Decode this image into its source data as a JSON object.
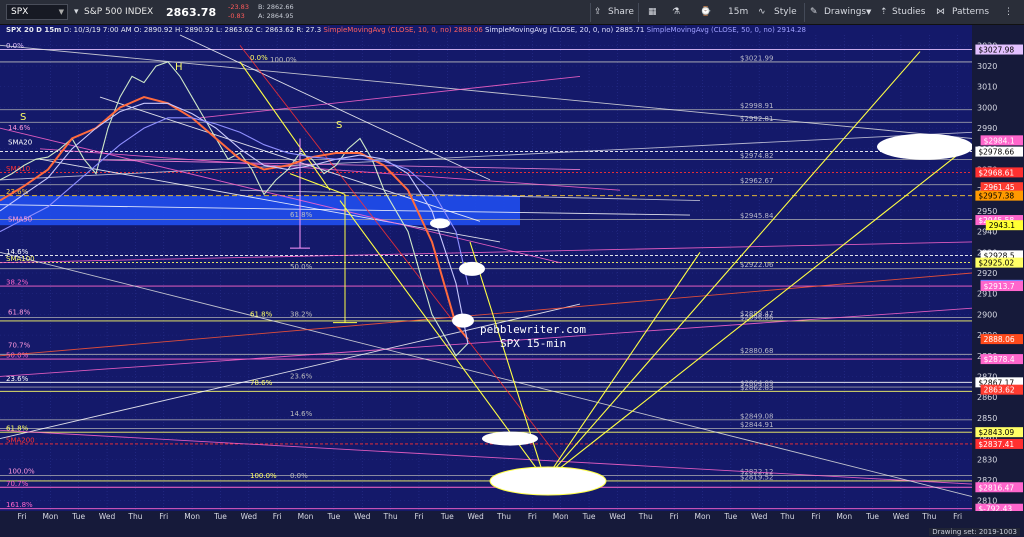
{
  "toolbar": {
    "symbol": "SPX",
    "instrument": "S&P 500 INDEX",
    "last_price": "2863.78",
    "change_pts": "-23.83",
    "change_pct": "-0.83",
    "bid": "B: 2862.66",
    "ask": "A: 2864.95",
    "share_label": "Share",
    "interval": "15m",
    "style_label": "Style",
    "drawings_label": "Drawings",
    "studies_label": "Studies",
    "patterns_label": "Patterns"
  },
  "status_line": {
    "title": "SPX 20 D 15m",
    "ohlc": "D: 10/3/19 7:00 AM   O: 2890.92   H: 2890.92   L: 2863.62   C: 2863.62   R: 27.3",
    "sma10_label": "SimpleMovingAvg (CLOSE, 10, 0, no)",
    "sma10_value": "2888.06",
    "sma20_label": "SimpleMovingAvg (CLOSE, 20, 0, no)",
    "sma20_value": "2885.71",
    "sma50_label": "SimpleMovingAvg (CLOSE, 50, 0, no)",
    "sma50_value": "2914.28"
  },
  "watermark": {
    "site": "pebblewriter.com",
    "subtitle": "SPX 15-min"
  },
  "drawing_set": "Drawing set: 2019-1003",
  "chart_data": {
    "type": "line",
    "title": "SPX 20 D 15m",
    "ylim": [
      2805,
      3035
    ],
    "yticks": [
      2810,
      2820,
      2830,
      2840,
      2850,
      2860,
      2870,
      2880,
      2890,
      2900,
      2910,
      2920,
      2930,
      2940,
      2950,
      2960,
      2970,
      2980,
      2990,
      3000,
      3010,
      3020,
      3030
    ],
    "x_labels": [
      "Fri",
      "Mon",
      "Tue",
      "Wed",
      "Thu",
      "Fri",
      "Mon",
      "Tue",
      "Wed",
      "Fri",
      "Mon",
      "Tue",
      "Wed",
      "Thu",
      "Fri",
      "Tue",
      "Wed",
      "Thu",
      "Fri",
      "Mon",
      "Tue",
      "Wed",
      "Thu",
      "Fri",
      "Mon",
      "Tue",
      "Wed",
      "Thu",
      "Fri",
      "Mon",
      "Tue",
      "Wed",
      "Thu",
      "Fri"
    ],
    "series": [
      {
        "name": "SPX",
        "color": "#cfe8c8",
        "x": [
          0,
          4,
          8,
          12,
          16,
          20,
          24,
          28,
          32,
          36,
          40,
          44,
          48,
          52,
          56,
          60,
          64,
          68,
          72,
          76,
          80,
          84,
          88,
          92,
          96,
          100,
          104,
          108,
          112,
          116,
          120,
          124,
          128,
          132,
          136,
          140,
          144,
          148,
          152,
          156
        ],
        "values": [
          2965,
          2968,
          2972,
          2975,
          2976,
          2980,
          2985,
          2975,
          2968,
          2990,
          3005,
          3015,
          3012,
          3020,
          3022,
          3015,
          3005,
          2995,
          2985,
          2975,
          2978,
          2970,
          2958,
          2965,
          2970,
          2978,
          2975,
          2968,
          2972,
          2980,
          2985,
          2975,
          2960,
          2950,
          2940,
          2920,
          2900,
          2890,
          2880,
          2886
        ]
      },
      {
        "name": "SMA10",
        "color": "#ff6a3d",
        "x": [
          0,
          8,
          16,
          24,
          32,
          40,
          48,
          56,
          64,
          72,
          80,
          88,
          96,
          104,
          112,
          120,
          128,
          136,
          144,
          152,
          156
        ],
        "values": [
          2955,
          2962,
          2970,
          2985,
          2990,
          3000,
          3005,
          3002,
          2995,
          2985,
          2975,
          2970,
          2972,
          2976,
          2978,
          2978,
          2972,
          2960,
          2935,
          2895,
          2888
        ]
      },
      {
        "name": "SMA20",
        "color": "#c8c8ff",
        "x": [
          0,
          8,
          16,
          24,
          32,
          40,
          48,
          56,
          64,
          72,
          80,
          88,
          96,
          104,
          112,
          120,
          128,
          136,
          144,
          152,
          156
        ],
        "values": [
          2950,
          2958,
          2966,
          2980,
          2990,
          2998,
          3002,
          3002,
          2997,
          2990,
          2980,
          2972,
          2970,
          2972,
          2975,
          2977,
          2975,
          2968,
          2950,
          2915,
          2885.71
        ]
      },
      {
        "name": "SMA50",
        "color": "#8f8fff",
        "x": [
          0,
          8,
          16,
          24,
          32,
          40,
          48,
          56,
          64,
          72,
          80,
          88,
          96,
          104,
          112,
          120,
          128,
          136,
          144,
          152,
          156
        ],
        "values": [
          2940,
          2946,
          2952,
          2962,
          2972,
          2982,
          2990,
          2995,
          2995,
          2992,
          2988,
          2982,
          2978,
          2976,
          2975,
          2975,
          2974,
          2970,
          2960,
          2940,
          2914.28
        ]
      }
    ],
    "right_axis_tags": [
      {
        "value": 3027.98,
        "label": "$3027.98",
        "bg": "#e3c1ff",
        "fg": "#000000"
      },
      {
        "value": 2984.1,
        "label": "$2984.1",
        "bg": "#ff66cc",
        "fg": "#ffffff"
      },
      {
        "value": 2978.66,
        "label": "$2978.66",
        "bg": "#ffffff",
        "fg": "#000000"
      },
      {
        "value": 2968.61,
        "label": "$2968.61",
        "bg": "#ff3030",
        "fg": "#ffffff"
      },
      {
        "value": 2961.45,
        "label": "2961.45",
        "bg": "#ff3b30",
        "fg": "#ffffff"
      },
      {
        "value": 2957.38,
        "label": "$2957.38",
        "bg": "#ff9900",
        "fg": "#000000"
      },
      {
        "value": 2945.58,
        "label": "$2945.58",
        "bg": "#ff66cc",
        "fg": "#ffffff"
      },
      {
        "value": 2943.1,
        "label": "2943.1",
        "bg": "#ffff33",
        "fg": "#000000"
      },
      {
        "value": 2928.5,
        "label": "$2928.5",
        "bg": "#ffffff",
        "fg": "#000000"
      },
      {
        "value": 2925.02,
        "label": "$2925.02",
        "bg": "#ffff66",
        "fg": "#000000"
      },
      {
        "value": 2914.28,
        "label": "2914.28",
        "bg": "#7f7fff",
        "fg": "#ffffff"
      },
      {
        "value": 2913.7,
        "label": "$2913.7",
        "bg": "#ff66cc",
        "fg": "#ffffff"
      },
      {
        "value": 2888.06,
        "label": "2888.06",
        "bg": "#ff4a1c",
        "fg": "#ffffff"
      },
      {
        "value": 2878.4,
        "label": "$2878.4",
        "bg": "#ff66cc",
        "fg": "#ffffff"
      },
      {
        "value": 2867.17,
        "label": "$2867.17",
        "bg": "#ffffff",
        "fg": "#000000"
      },
      {
        "value": 2863.62,
        "label": "2863.62",
        "bg": "#ff3b30",
        "fg": "#ffffff"
      },
      {
        "value": 2843.09,
        "label": "$2843.09",
        "bg": "#ffff66",
        "fg": "#000000"
      },
      {
        "value": 2837.41,
        "label": "$2837.41",
        "bg": "#ff3030",
        "fg": "#ffffff"
      },
      {
        "value": 2816.47,
        "label": "$2816.47",
        "bg": "#ff66cc",
        "fg": "#ffffff"
      },
      {
        "value": 2806.1,
        "label": "$-792.43",
        "bg": "#ff66cc",
        "fg": "#ffffff"
      }
    ],
    "horizontal_levels": [
      {
        "value": 3027.98,
        "color": "#e3c1ff",
        "dash": "",
        "label_left": "0.0%"
      },
      {
        "value": 3021.99,
        "color": "#bdbdbd",
        "dash": "",
        "label_mid": "$3021.99"
      },
      {
        "value": 2998.91,
        "color": "#9a9aa8",
        "dash": "",
        "label_mid": "$2998.91"
      },
      {
        "value": 2992.81,
        "color": "#9a9aa8",
        "dash": "",
        "label_mid": "$2992.81"
      },
      {
        "value": 2978.66,
        "color": "#ffffff",
        "dash": "3,2",
        "label_mid": ""
      },
      {
        "value": 2974.82,
        "color": "#9a9aa8",
        "dash": "",
        "label_mid": "$2974.82"
      },
      {
        "value": 2968.61,
        "color": "#ff3030",
        "dash": "2,2",
        "label_left": "SMA10"
      },
      {
        "value": 2962.67,
        "color": "#9a9aa8",
        "dash": "",
        "label_mid": "$2962.67"
      },
      {
        "value": 2957.38,
        "color": "#ffcc33",
        "dash": "5,3",
        "label_left": "23.6%"
      },
      {
        "value": 2945.84,
        "color": "#9a9aa8",
        "dash": "",
        "label_mid": "$2945.84"
      },
      {
        "value": 2928.5,
        "color": "#ffffff",
        "dash": "3,2",
        "label_left": "14.6%"
      },
      {
        "value": 2925.02,
        "color": "#ffff66",
        "dash": "2,2",
        "label_left": "SMA100"
      },
      {
        "value": 2922.06,
        "color": "#9a9aa8",
        "dash": "",
        "label_mid": "$2922.06"
      },
      {
        "value": 2913.7,
        "color": "#ff66cc",
        "dash": "",
        "label_left": "38.2%"
      },
      {
        "value": 2898.47,
        "color": "#9a9aa8",
        "dash": "",
        "label_mid": "$2898.47"
      },
      {
        "value": 2896.86,
        "color": "#ffff66",
        "dash": "",
        "label_mid": "$2896.86"
      },
      {
        "value": 2880.68,
        "color": "#9a9aa8",
        "dash": "",
        "label_mid": "$2880.68"
      },
      {
        "value": 2878.4,
        "color": "#ff66cc",
        "dash": "",
        "label_left": "50.0%"
      },
      {
        "value": 2867.17,
        "color": "#ffffff",
        "dash": "",
        "label_left": "23.6%"
      },
      {
        "value": 2864.89,
        "color": "#9a9aa8",
        "dash": "",
        "label_mid": "$2864.89"
      },
      {
        "value": 2862.83,
        "color": "#ffff66",
        "dash": "",
        "label_mid": "$2862.83"
      },
      {
        "value": 2849.08,
        "color": "#9a9aa8",
        "dash": "",
        "label_mid": "$2849.08"
      },
      {
        "value": 2844.91,
        "color": "#9a9aa8",
        "dash": "",
        "label_mid": "$2844.91"
      },
      {
        "value": 2843.09,
        "color": "#ffff66",
        "dash": "",
        "label_left": "61.8%"
      },
      {
        "value": 2837.41,
        "color": "#ff3030",
        "dash": "3,2",
        "label_left": "SMA200"
      },
      {
        "value": 2822.12,
        "color": "#9a9aa8",
        "dash": "",
        "label_mid": "$2822.12"
      },
      {
        "value": 2819.52,
        "color": "#ffff66",
        "dash": "",
        "label_mid": "$2819.52"
      },
      {
        "value": 2816.47,
        "color": "#ff66cc",
        "dash": "",
        "label_left": "70.7%"
      },
      {
        "value": 2806.1,
        "color": "#ff66cc",
        "dash": "",
        "label_left": "161.8%"
      }
    ],
    "fib_labels": [
      {
        "x": 250,
        "value": 3023,
        "text": "0.0%",
        "color": "#ffff66"
      },
      {
        "x": 270,
        "value": 3022,
        "text": "100.0%",
        "color": "#bdbdbd"
      },
      {
        "x": 8,
        "value": 2989,
        "text": "14.6%",
        "color": "#ff99dd"
      },
      {
        "x": 250,
        "value": 2899,
        "text": "61.8%",
        "color": "#ffff66"
      },
      {
        "x": 290,
        "value": 2899,
        "text": "38.2%",
        "color": "#bdbdbd"
      },
      {
        "x": 8,
        "value": 2884,
        "text": "70.7%",
        "color": "#ff99dd"
      },
      {
        "x": 250,
        "value": 2866,
        "text": "78.6%",
        "color": "#ffff66"
      },
      {
        "x": 290,
        "value": 2869,
        "text": "23.6%",
        "color": "#bdbdbd"
      },
      {
        "x": 290,
        "value": 2851,
        "text": "14.6%",
        "color": "#bdbdbd"
      },
      {
        "x": 250,
        "value": 2821,
        "text": "100.0%",
        "color": "#ffff66"
      },
      {
        "x": 290,
        "value": 2821,
        "text": "0.0%",
        "color": "#bdbdbd"
      },
      {
        "x": 8,
        "value": 2823,
        "text": "100.0%",
        "color": "#ff99dd"
      },
      {
        "x": 290,
        "value": 2922,
        "text": "50.0%",
        "color": "#bdbdbd"
      },
      {
        "x": 290,
        "value": 2947,
        "text": "61.8%",
        "color": "#bdbdbd"
      },
      {
        "x": 8,
        "value": 2900,
        "text": "61.8%",
        "color": "#ff99dd"
      }
    ],
    "pattern_labels": [
      {
        "x": 175,
        "value": 3018,
        "text": "H",
        "color": "#ffff66"
      },
      {
        "x": 20,
        "value": 2994,
        "text": "S",
        "color": "#ffff66"
      },
      {
        "x": 336,
        "value": 2990,
        "text": "S",
        "color": "#ffff66"
      },
      {
        "x": 8,
        "value": 2982,
        "text": "SMA20",
        "color": "#ffffff"
      },
      {
        "x": 8,
        "value": 2945,
        "text": "SMA50",
        "color": "#ff99dd"
      }
    ],
    "grid": true,
    "highlight_band": {
      "from": 2943.1,
      "to": 2957.38,
      "color": "#1f4ef0"
    }
  }
}
